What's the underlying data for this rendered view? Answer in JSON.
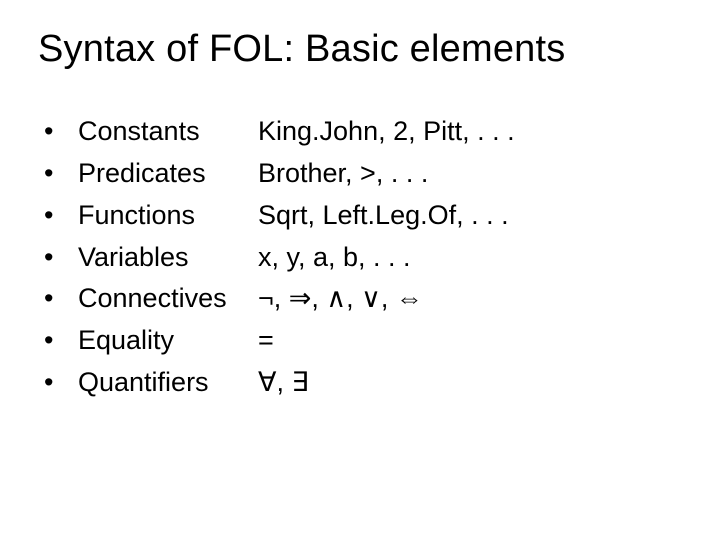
{
  "title": "Syntax of FOL: Basic elements",
  "rows": [
    {
      "label": "Constants",
      "examples": "King.John, 2, Pitt, . . ."
    },
    {
      "label": "Predicates",
      "examples": "Brother, >, . . ."
    },
    {
      "label": "Functions",
      "examples": "Sqrt, Left.Leg.Of, . . ."
    },
    {
      "label": "Variables",
      "examples": "x, y, a, b, . . ."
    },
    {
      "label": "Connectives",
      "examples": "¬, ⇒, ∧, ∨, ⇔"
    },
    {
      "label": "Equality",
      "examples": "="
    },
    {
      "label": "Quantifiers",
      "examples": "∀, ∃"
    }
  ],
  "bullet": "•"
}
